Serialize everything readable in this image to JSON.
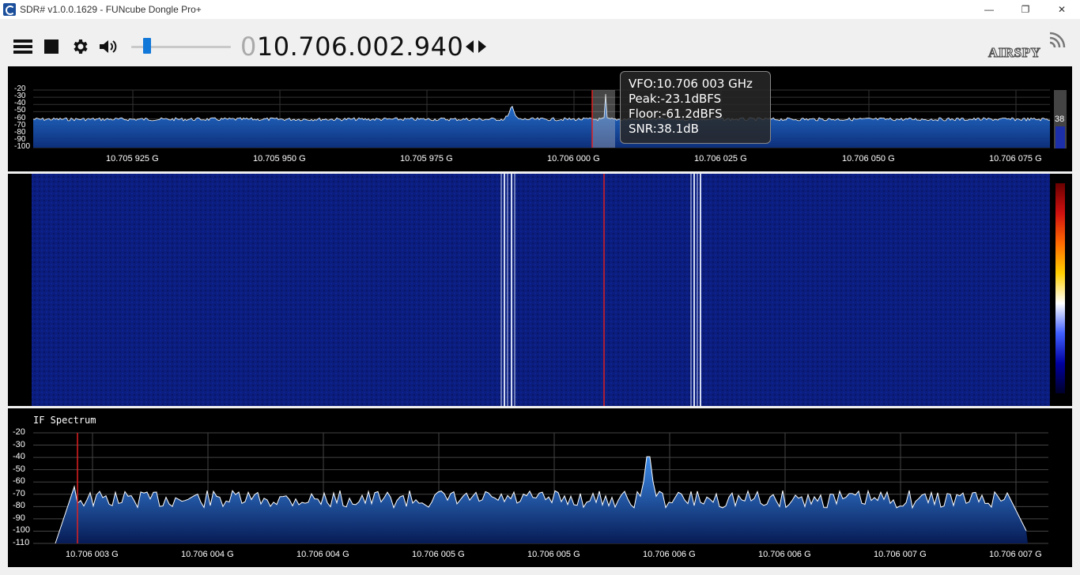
{
  "window": {
    "title": "SDR# v1.0.0.1629 - FUNcube Dongle Pro+",
    "minimize_glyph": "—",
    "restore_glyph": "❐",
    "close_glyph": "✕"
  },
  "toolbar": {
    "frequency_lead": "0",
    "frequency_main": "10.706.002.940",
    "volume_fraction": 0.15,
    "logo_text": "AIRSPY"
  },
  "spectrum": {
    "y_ticks": [
      "-20",
      "-30",
      "-40",
      "-50",
      "-60",
      "-70",
      "-80",
      "-90",
      "-100"
    ],
    "x_ticks": [
      "10.705 925 G",
      "10.705 950 G",
      "10.705 975 G",
      "10.706 000 G",
      "10.706 025 G",
      "10.706 050 G",
      "10.706 075 G"
    ],
    "tooltip": {
      "vfo": "VFO:10.706 003 GHz",
      "peak": "Peak:-23.1dBFS",
      "floor": "Floor:-61.2dBFS",
      "snr": "SNR:38.1dB"
    },
    "gain_value": "38"
  },
  "if_spectrum": {
    "title": "IF Spectrum",
    "y_ticks": [
      "-20",
      "-30",
      "-40",
      "-50",
      "-60",
      "-70",
      "-80",
      "-90",
      "-100",
      "-110"
    ],
    "x_ticks": [
      "10.706 003 G",
      "10.706 004 G",
      "10.706 004 G",
      "10.706 005 G",
      "10.706 005 G",
      "10.706 006 G",
      "10.706 006 G",
      "10.706 007 G",
      "10.706 007 G"
    ]
  },
  "colors": {
    "accent": "#1177d8",
    "spectrum_fill": "#1a5fb4",
    "waterfall_bg": "#0a1c7a",
    "vfo_marker": "#e02020"
  }
}
